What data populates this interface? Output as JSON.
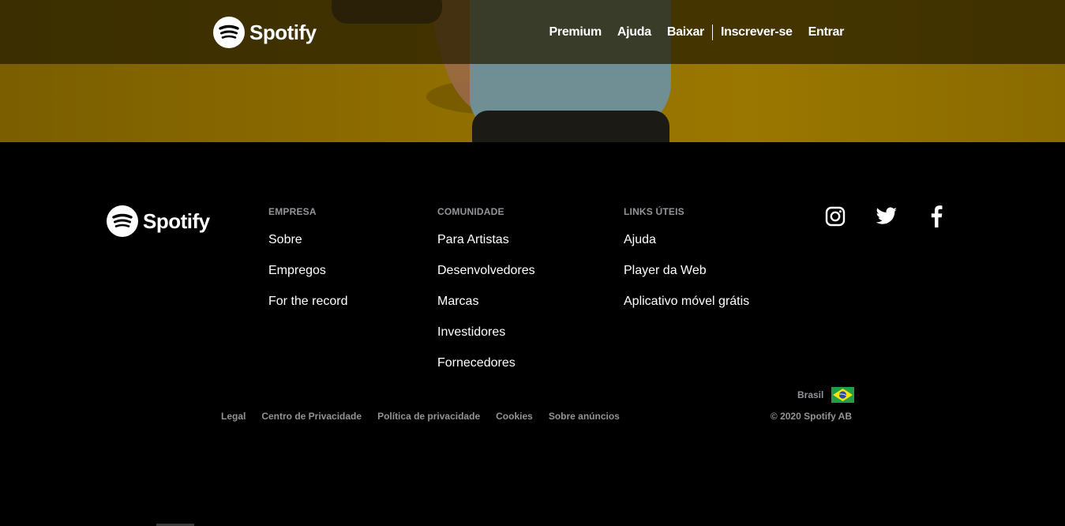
{
  "brand": {
    "name": "Spotify",
    "accent": "#ffffff"
  },
  "nav": {
    "links": [
      "Premium",
      "Ajuda",
      "Baixar",
      "Inscrever-se",
      "Entrar"
    ]
  },
  "footer": {
    "columns": [
      {
        "heading": "EMPRESA",
        "items": [
          "Sobre",
          "Empregos",
          "For the record"
        ]
      },
      {
        "heading": "COMUNIDADE",
        "items": [
          "Para Artistas",
          "Desenvolvedores",
          "Marcas",
          "Investidores",
          "Fornecedores"
        ]
      },
      {
        "heading": "LINKS ÚTEIS",
        "items": [
          "Ajuda",
          "Player da Web",
          "Aplicativo móvel grátis"
        ]
      }
    ],
    "social": [
      {
        "name": "instagram-icon"
      },
      {
        "name": "twitter-icon"
      },
      {
        "name": "facebook-icon"
      }
    ],
    "region": {
      "label": "Brasil",
      "flag": "brazil-flag-icon"
    },
    "legal_links": [
      "Legal",
      "Centro de Privacidade",
      "Política de privacidade",
      "Cookies",
      "Sobre anúncios"
    ],
    "copyright": "© 2020 Spotify AB"
  },
  "colors": {
    "background": "#000000",
    "muted_text": "#919496",
    "hero_yellow": "#8f6d00"
  }
}
